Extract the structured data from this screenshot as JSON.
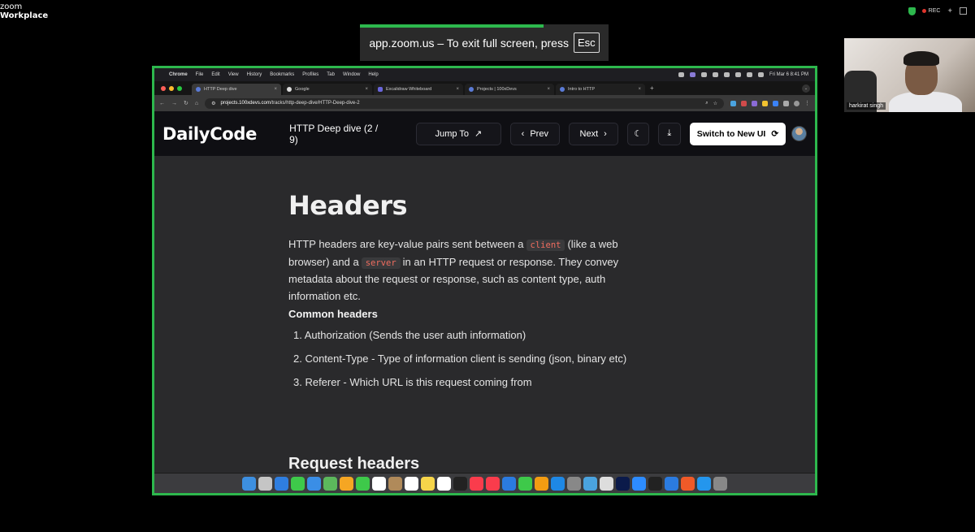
{
  "zoom": {
    "logo_line1": "zoom",
    "logo_line2": "Workplace",
    "rec_label": "REC",
    "fullscreen_notice": "app.zoom.us – To exit full screen, press",
    "esc_key": "Esc",
    "participant_name": "harkirat singh"
  },
  "mac_menubar": {
    "app": "Chrome",
    "items": [
      "File",
      "Edit",
      "View",
      "History",
      "Bookmarks",
      "Profiles",
      "Tab",
      "Window",
      "Help"
    ],
    "clock": "Fri Mar 6  8:41 PM"
  },
  "browser": {
    "tabs": [
      {
        "label": "HTTP Deep dive",
        "active": true
      },
      {
        "label": "Google",
        "active": false
      },
      {
        "label": "Excalidraw Whiteboard",
        "active": false
      },
      {
        "label": "Projects | 100xDevs",
        "active": false
      },
      {
        "label": "Intro to HTTP",
        "active": false
      }
    ],
    "url_host": "projects.100xdevs.com",
    "url_path": "/tracks/http-deep-dive/HTTP-Deep-dive-2"
  },
  "site_header": {
    "logo": "DailyCode",
    "track_title": "HTTP Deep dive (2 / 9)",
    "jump_label": "Jump To",
    "prev_label": "Prev",
    "next_label": "Next",
    "switch_label": "Switch to New UI"
  },
  "article": {
    "heading": "Headers",
    "para_1": "HTTP headers are key-value pairs sent between a",
    "code_client": "client",
    "para_2": "(like a web browser) and a",
    "code_server": "server",
    "para_3": "in an HTTP request or response. They convey metadata about the request or response, such as content type, auth information etc.",
    "subheading": "Common headers",
    "list": [
      "1. Authorization (Sends the user auth information)",
      "2. Content-Type - Type of information client is sending (json, binary etc)",
      "3. Referer - Which URL is this request coming from"
    ],
    "next_heading": "Request headers"
  },
  "colors": {
    "zoom_green": "#2db84d",
    "code_text": "#f06d5f",
    "page_bg": "#2a2a2c",
    "header_bg": "#0f0f13"
  },
  "dock_icons": [
    "finder-icon",
    "launchpad-icon",
    "safari-icon",
    "messages-icon",
    "mail-icon",
    "maps-icon",
    "photos-icon",
    "facetime-icon",
    "calendar-icon",
    "contacts-icon",
    "reminders-icon",
    "notes-icon",
    "freeform-icon",
    "tv-icon",
    "music-icon",
    "news-icon",
    "keynote-icon",
    "numbers-icon",
    "pages-icon",
    "appstore-icon",
    "settings-icon",
    "xcode-icon",
    "chrome-icon",
    "premiere-icon",
    "zoom-icon",
    "terminal-icon",
    "vscode-icon",
    "brave-icon",
    "docker-icon",
    "trash-icon"
  ]
}
